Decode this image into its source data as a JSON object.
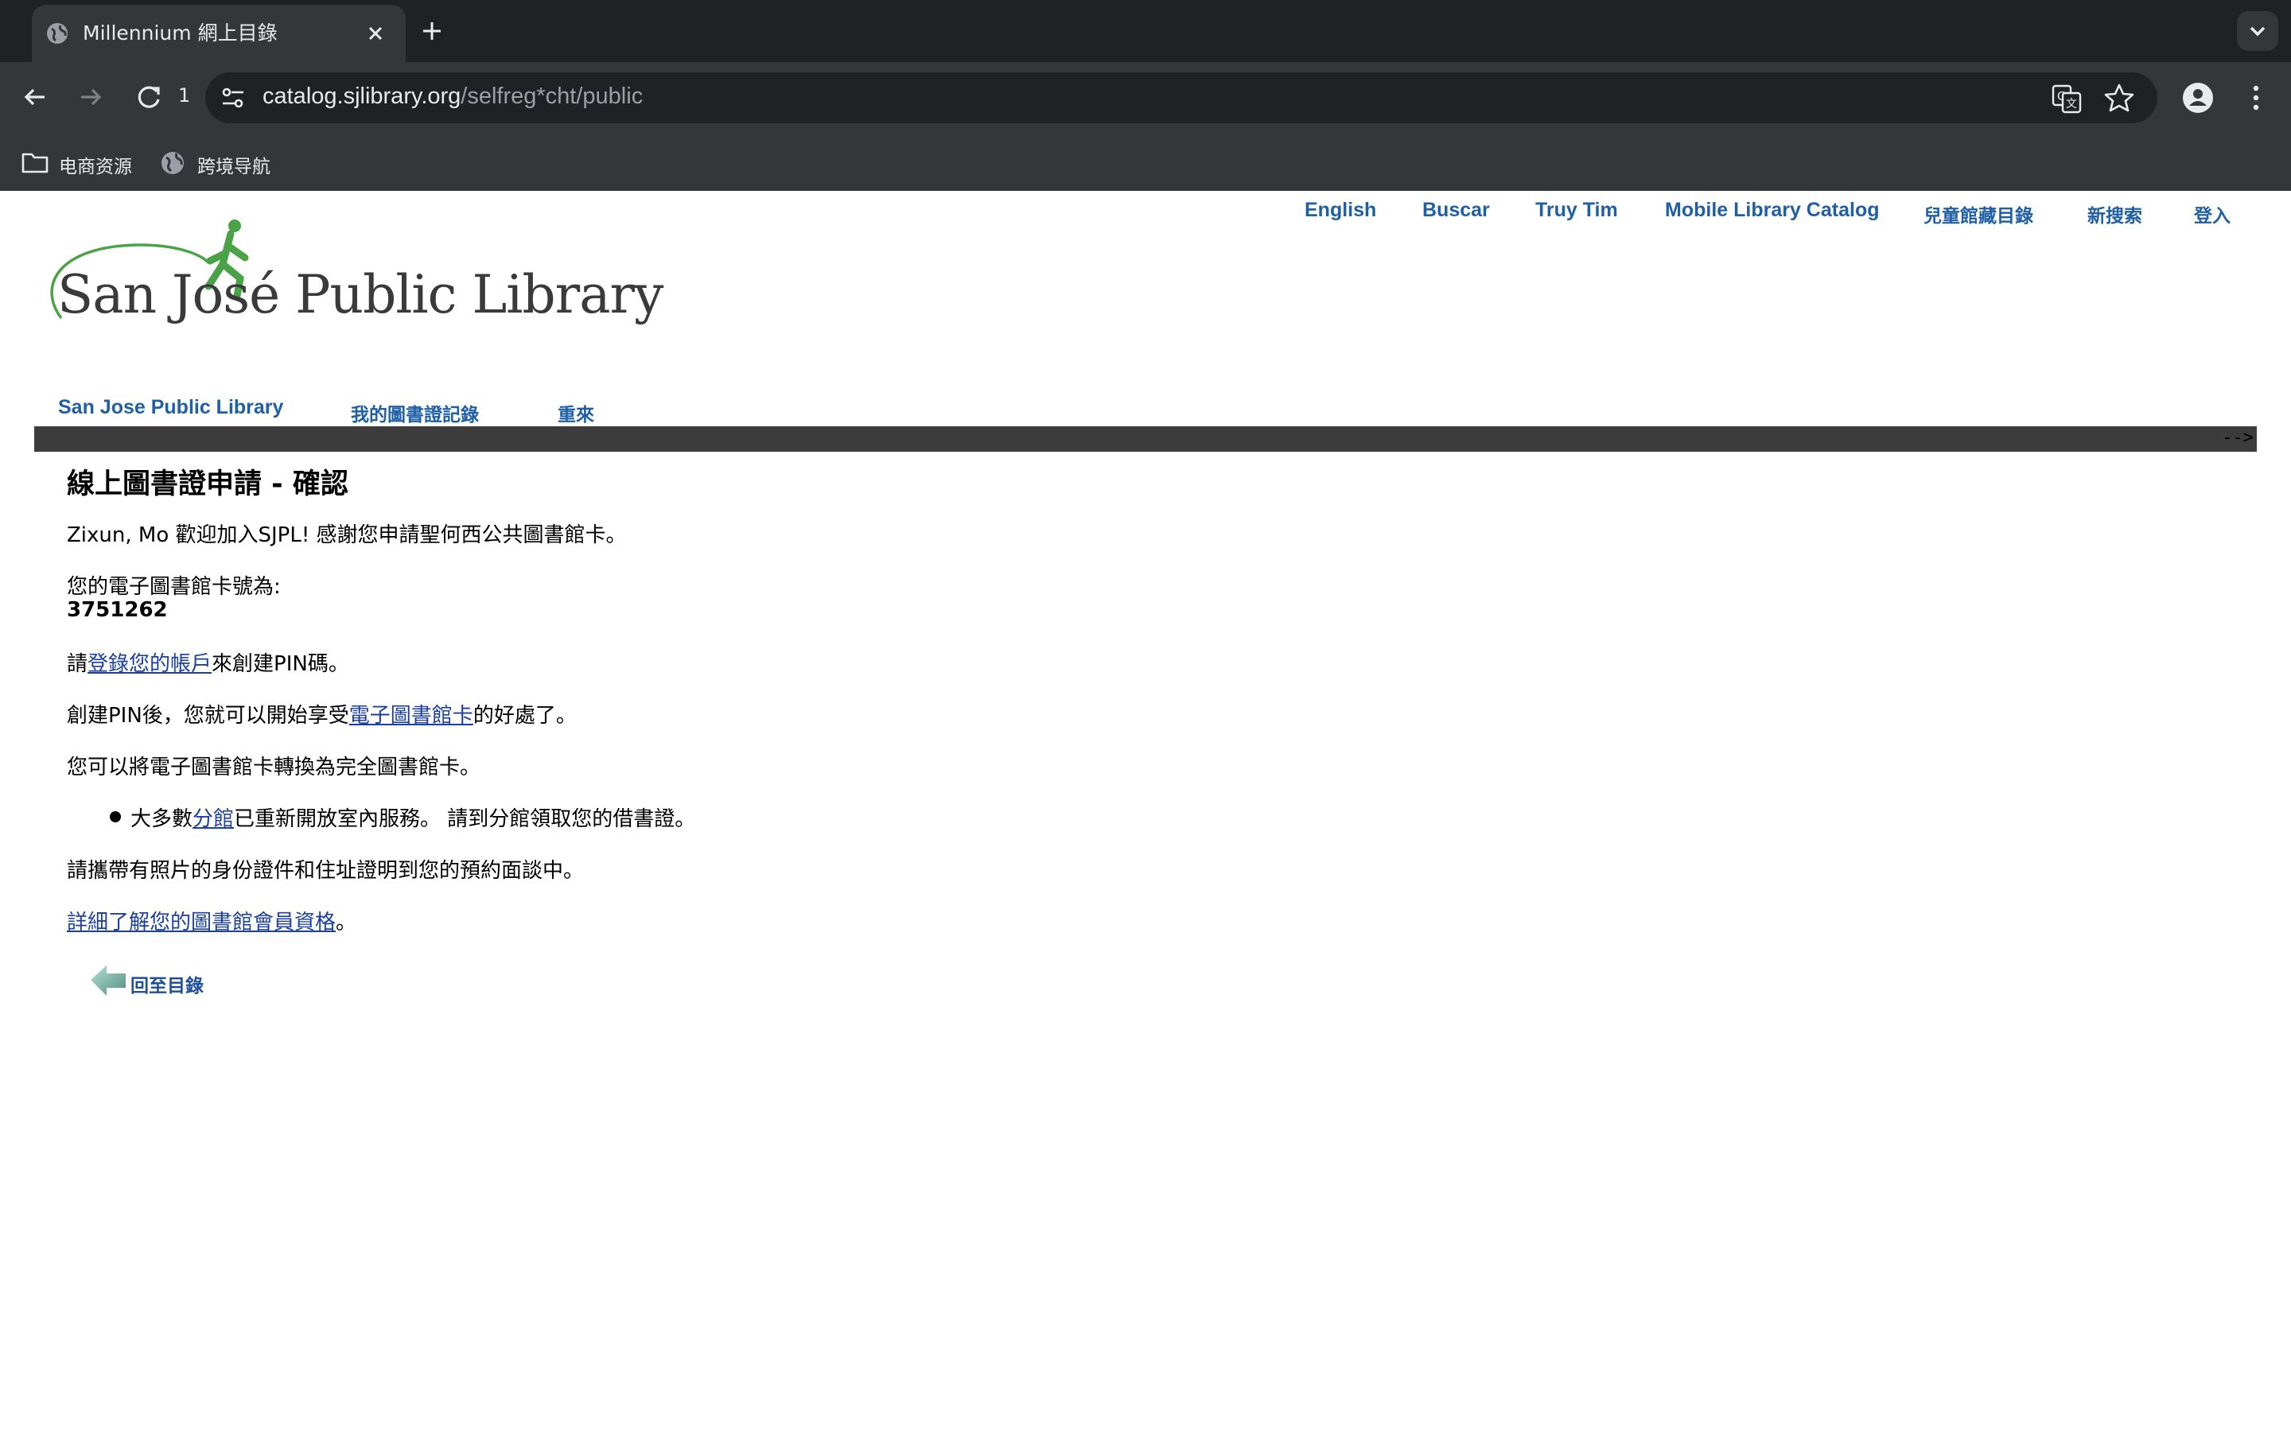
{
  "browser": {
    "tab_title": "Millennium 網上目錄",
    "reload_count": "1",
    "url_host": "catalog.sjlibrary.org",
    "url_path": "/selfreg*cht/public",
    "bookmarks": [
      {
        "label": "电商资源",
        "icon": "folder-icon"
      },
      {
        "label": "跨境导航",
        "icon": "globe-icon"
      }
    ]
  },
  "site": {
    "logo_text": "San José Public Library",
    "top_links": [
      "English",
      "Buscar",
      "Truy Tim",
      "Mobile Library Catalog",
      "兒童館藏目錄",
      "新搜索",
      "登入"
    ],
    "nav_links": [
      "San Jose Public Library",
      "我的圖書證記錄",
      "重來"
    ],
    "bar_marker": "-->"
  },
  "content": {
    "heading": "線上圖書證申請 - 確認",
    "welcome": "Zixun, Mo 歡迎加入SJPL!  感謝您申請聖何西公共圖書館卡。",
    "card_label": "您的電子圖書館卡號為:",
    "card_number": "3751262",
    "pin_pre": "請",
    "pin_link": "登錄您的帳戶",
    "pin_post": "來創建PIN碼。",
    "enjoy_pre": "創建PIN後，您就可以開始享受",
    "enjoy_link": "電子圖書館卡",
    "enjoy_post": "的好處了。",
    "convert": "您可以將電子圖書館卡轉換為完全圖書館卡。",
    "bullet_pre": "大多數",
    "bullet_link": "分館",
    "bullet_post": "已重新開放室內服務。 請到分館領取您的借書證。",
    "bring_docs": "請攜帶有照片的身份證件和住址證明到您的預約面談中。",
    "learn_more_link": "詳細了解您的圖書館會員資格",
    "learn_more_post": "。",
    "back_label": "回至目錄"
  },
  "colors": {
    "link_blue": "#1f5fa6",
    "bar_dark": "#3c3c3c",
    "logo_green": "#4aa246"
  }
}
